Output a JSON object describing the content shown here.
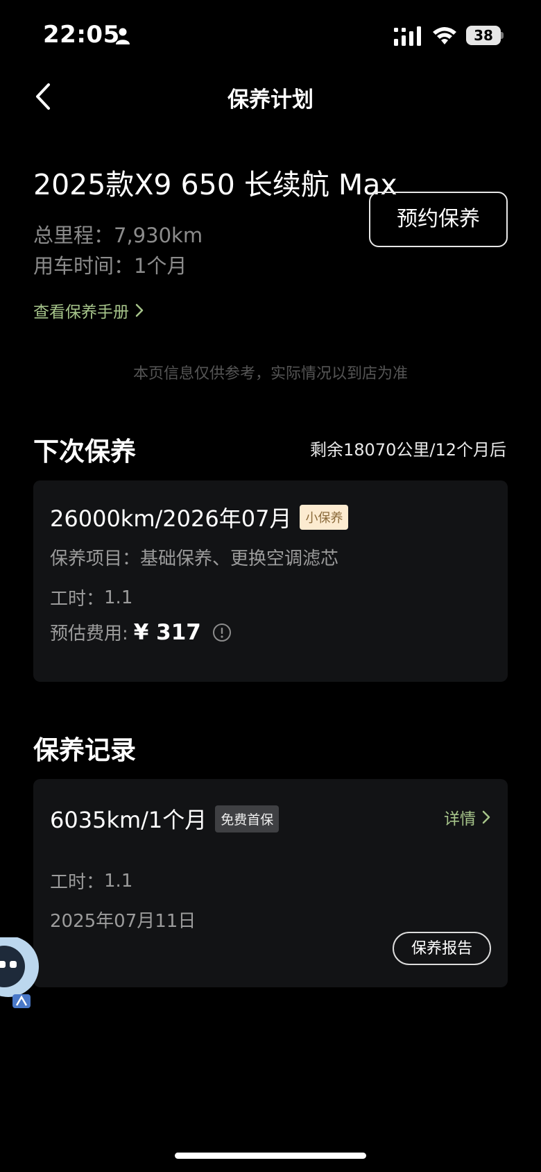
{
  "status_bar": {
    "time": "22:05",
    "battery": "38"
  },
  "nav": {
    "title": "保养计划"
  },
  "car": {
    "model": "2025款X9 650 长续航 Max",
    "mileage_label": "总里程：",
    "mileage_value": "7,930km",
    "usage_label": "用车时间：",
    "usage_value": "1个月",
    "book_button": "预约保养",
    "manual_link": "查看保养手册"
  },
  "disclaimer": "本页信息仅供参考，实际情况以到店为准",
  "next_maintenance": {
    "title": "下次保养",
    "remaining": "剩余18070公里/12个月后",
    "headline": "26000km/2026年07月",
    "tag": "小保养",
    "items_label": "保养项目：",
    "items_value": "基础保养、更换空调滤芯",
    "hours_label": "工时：",
    "hours_value": "1.1",
    "cost_label": "预估费用:",
    "cost_value": "¥ 317"
  },
  "records": {
    "title": "保养记录",
    "items": [
      {
        "headline": "6035km/1个月",
        "tag": "免费首保",
        "detail_link": "详情",
        "hours_label": "工时：",
        "hours_value": "1.1",
        "date": "2025年07月11日",
        "report_button": "保养报告"
      }
    ]
  },
  "colors": {
    "accent_green": "#a6c48a",
    "tag_minor_bg": "#fcebd0",
    "card_bg": "#121315"
  }
}
